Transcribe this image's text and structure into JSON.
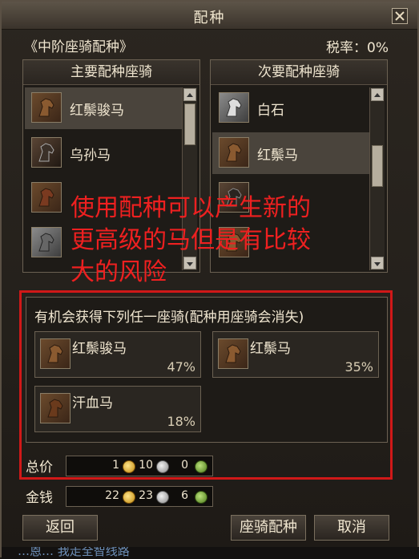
{
  "window": {
    "title": "配种",
    "close_icon": "close-icon"
  },
  "header": {
    "subtitle": "《中阶座骑配种》",
    "tax": "税率：0%"
  },
  "primary_panel": {
    "title": "主要配种座骑",
    "items": [
      {
        "label": "红鬃骏马",
        "icon": "horse-icon",
        "selected": true
      },
      {
        "label": "乌孙马",
        "icon": "horse-icon",
        "selected": false
      },
      {
        "label": "",
        "icon": "horse-icon",
        "selected": false
      },
      {
        "label": "",
        "icon": "horse-icon",
        "selected": false
      }
    ]
  },
  "secondary_panel": {
    "title": "次要配种座骑",
    "items": [
      {
        "label": "白石",
        "icon": "horse-icon",
        "selected": false
      },
      {
        "label": "红鬃马",
        "icon": "horse-icon",
        "selected": true
      },
      {
        "label": "",
        "icon": "horse-icon",
        "selected": false
      },
      {
        "label": "",
        "icon": "horse-icon",
        "selected": false
      }
    ]
  },
  "annotation": {
    "line1": "使用配种可以产生新的",
    "line2": "更高级的马但是有比较",
    "line3": "大的风险",
    "color": "#ee2020"
  },
  "results": {
    "title": "有机会获得下列任一座骑(配种用座骑会消失)",
    "items": [
      {
        "name": "红鬃骏马",
        "percent": "47%"
      },
      {
        "name": "红鬃马",
        "percent": "35%"
      },
      {
        "name": "汗血马",
        "percent": "18%"
      }
    ]
  },
  "total_price": {
    "label": "总价",
    "gold": "1",
    "silver": "10",
    "copper": "0"
  },
  "money": {
    "label": "金钱",
    "gold": "22",
    "silver": "23",
    "copper": "6"
  },
  "buttons": {
    "back": "返回",
    "breed": "座骑配种",
    "cancel": "取消"
  },
  "footer": {
    "text": "…恩… 我走全智线路"
  }
}
